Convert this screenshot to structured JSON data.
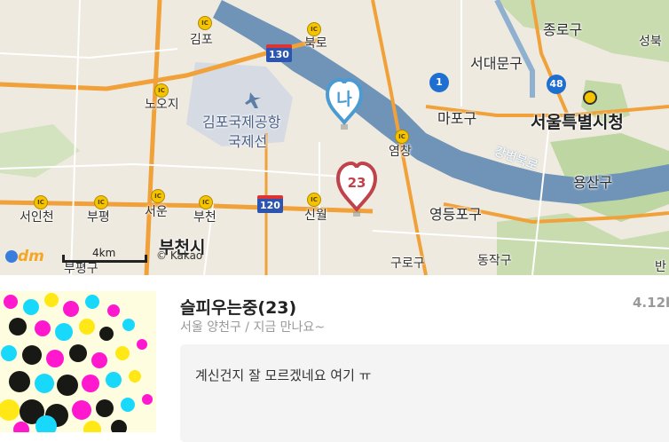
{
  "map": {
    "labels": {
      "gimpo": "김포",
      "bukro": "북로",
      "jongno": "종로구",
      "seongbuk": "성북",
      "seodaemun": "서대문구",
      "noji": "노오지",
      "airport1": "김포국제공항",
      "airport2": "국제선",
      "mapo": "마포구",
      "cityhall": "서울특별시청",
      "yeomchang": "염창",
      "gangbyeon": "강변북로",
      "yongsan": "용산구",
      "seoincheon": "서인천",
      "bupyeong": "부평",
      "seoun": "서운",
      "bucheon_ic": "부천",
      "sinwol": "신월",
      "yeongdeungpo": "영등포구",
      "bucheon": "부천시",
      "bupyeonggu": "부평구",
      "guro": "구로구",
      "dongjak": "동작구",
      "ban": "반"
    },
    "routes": {
      "r130": "130",
      "r1": "1",
      "r48": "48",
      "r120": "120"
    },
    "ic_label": "IC",
    "markers": {
      "me": {
        "label": "나",
        "color": "#4a9bd4"
      },
      "other": {
        "label": "23",
        "color": "#c0424a"
      }
    },
    "scale_label": "4km",
    "logo": "dm",
    "copyright": "© Kakao"
  },
  "profile": {
    "name": "슬피우는중(23)",
    "location": "서울 양천구 / 지금 만나요~",
    "distance": "4.12k",
    "message": "계신건지 잘 모르겠네요 여기 ㅠ"
  },
  "colors": {
    "map_bg": "#efeadf",
    "river": "#6f94b8",
    "highway": "#f0a13a",
    "green": "#b9d49c",
    "airport": "#d6dbe3"
  }
}
